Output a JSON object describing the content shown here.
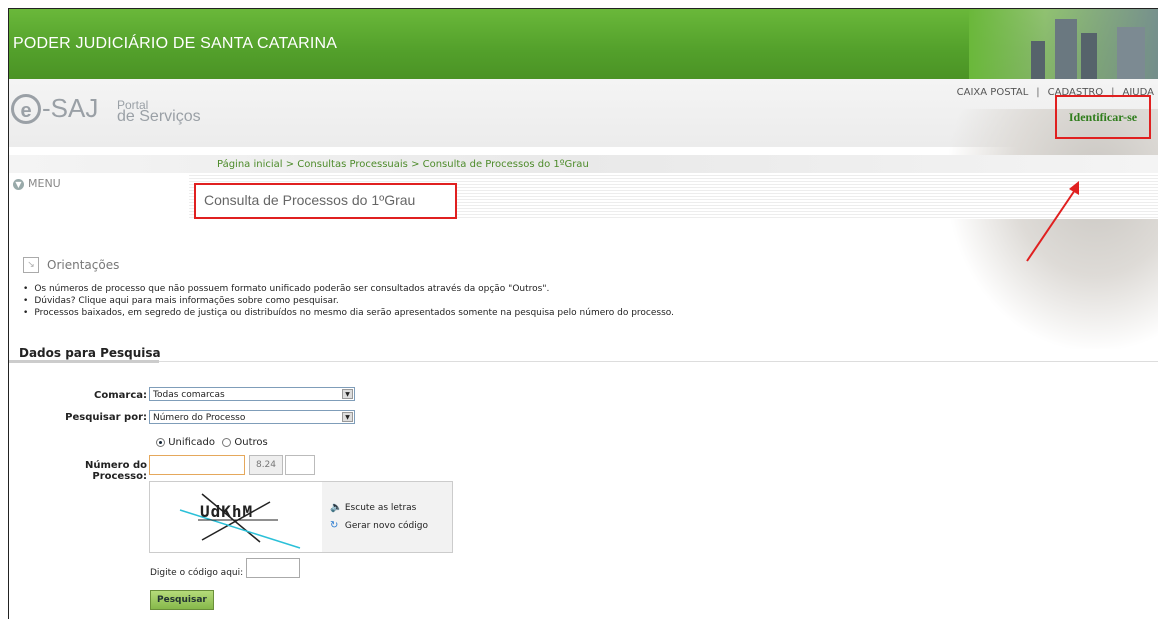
{
  "header": {
    "title": "PODER JUDICIÁRIO DE SANTA CATARINA"
  },
  "logo": {
    "mark": "e",
    "name": "-SAJ",
    "portal_line1": "Portal",
    "portal_line2": "de Serviços"
  },
  "toplinks": [
    "CAIXA POSTAL",
    "CADASTRO",
    "AJUDA"
  ],
  "identify": {
    "label": "Identificar-se"
  },
  "breadcrumb": "Página inicial > Consultas Processuais > Consulta de Processos do 1ºGrau",
  "menu": {
    "label": "MENU"
  },
  "page_title": "Consulta de Processos do 1ºGrau",
  "orientacoes": {
    "title": "Orientações",
    "items": [
      "Os números de processo que não possuem formato unificado poderão ser consultados através da opção \"Outros\".",
      "Dúvidas? Clique aqui para mais informações sobre como pesquisar.",
      "Processos baixados, em segredo de justiça ou distribuídos no mesmo dia serão apresentados somente na pesquisa pelo número do processo."
    ]
  },
  "section_title": "Dados para Pesquisa",
  "form": {
    "comarca_label": "Comarca:",
    "comarca_value": "Todas comarcas",
    "pesquisar_label": "Pesquisar por:",
    "pesquisar_value": "Número do Processo",
    "radio_unificado": "Unificado",
    "radio_outros": "Outros",
    "numero_label": "Número do Processo:",
    "numero_value": "",
    "suffix_value": "8.24",
    "captcha_text": "UdKhM",
    "listen_label": "Escute as letras",
    "new_code_label": "Gerar novo código",
    "code_label": "Digite o código aqui:",
    "submit_label": "Pesquisar"
  },
  "colors": {
    "header_green": "#53a02b",
    "highlight_red": "#e02020",
    "link_green": "#4d8b2a"
  }
}
